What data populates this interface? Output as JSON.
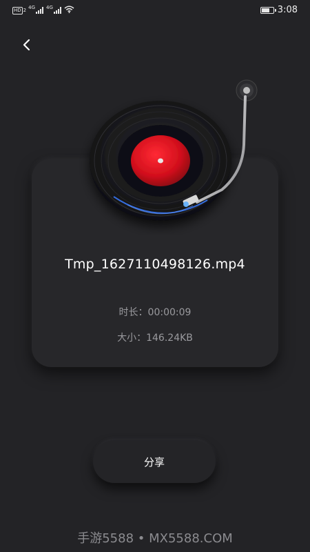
{
  "status_bar": {
    "hd_badge": "HD",
    "hd_sub": "2",
    "network_1": "4G",
    "network_2": "4G",
    "time": "3:08",
    "battery_level": 0.75,
    "icons": [
      "hd-icon",
      "signal-icon",
      "signal-icon",
      "wifi-icon",
      "battery-icon"
    ]
  },
  "header": {
    "back_icon": "chevron-left-icon"
  },
  "player": {
    "file_name": "Tmp_1627110498126.mp4",
    "duration_label": "时长：",
    "duration_value": "00:00:09",
    "size_label": "大小：",
    "size_value": "146.24KB"
  },
  "actions": {
    "share_label": "分享"
  },
  "watermark": "手游5588 • MX5588.COM",
  "colors": {
    "background": "#232326",
    "card": "#27272a",
    "record_label": "#e01020",
    "accent_glow": "#3a7bff"
  }
}
